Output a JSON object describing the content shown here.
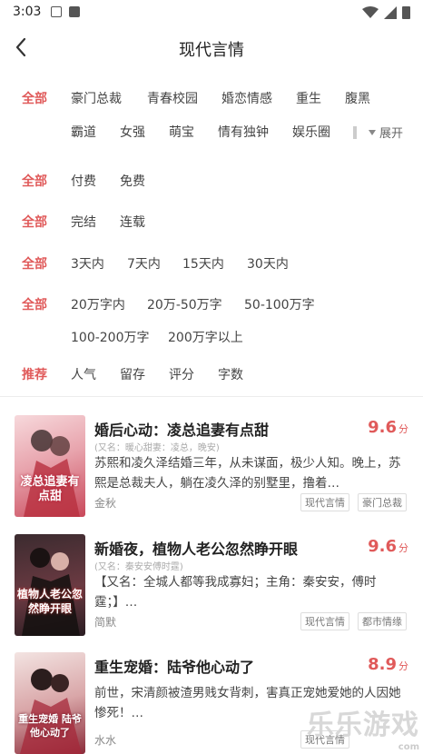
{
  "status": {
    "time": "3:03"
  },
  "header": {
    "title": "现代言情"
  },
  "filters": {
    "row1": [
      "全部",
      "豪门总裁",
      "青春校园",
      "婚恋情感",
      "重生",
      "腹黑"
    ],
    "row2": [
      "霸道",
      "女强",
      "萌宝",
      "情有独钟",
      "娱乐圈"
    ],
    "expand_label": "展开",
    "pay": [
      "全部",
      "付费",
      "免费"
    ],
    "progress": [
      "全部",
      "完结",
      "连载"
    ],
    "time": [
      "全部",
      "3天内",
      "7天内",
      "15天内",
      "30天内"
    ],
    "words_a": [
      "全部",
      "20万字内",
      "20万-50万字",
      "50-100万字"
    ],
    "words_b": [
      "100-200万字",
      "200万字以上"
    ],
    "sort": [
      "推荐",
      "人气",
      "留存",
      "评分",
      "字数"
    ]
  },
  "books": [
    {
      "title": "婚后心动：凌总追妻有点甜",
      "alias": "(又名：暖心甜妻：凌总，晚安)",
      "desc": "苏熙和凌久泽结婚三年，从未谋面，极少人知。晚上，苏熙是总裁夫人，躺在凌久泽的别墅里，撸着…",
      "author": "金秋",
      "tags": [
        "现代言情",
        "豪门总裁"
      ],
      "score": "9.6",
      "unit": "分",
      "cover_text": "凌总追妻有点甜"
    },
    {
      "title": "新婚夜，植物人老公忽然睁开眼",
      "alias": "(又名：秦安安傅时霆)",
      "desc": "【又名：全城人都等我成寡妇；主角：秦安安，傅时霆；】…",
      "author": "简默",
      "tags": [
        "现代言情",
        "都市情缘"
      ],
      "score": "9.6",
      "unit": "分",
      "cover_text": "植物人老公忽然睁开眼"
    },
    {
      "title": "重生宠婚：陆爷他心动了",
      "alias": "",
      "desc": "前世，宋清颜被渣男贱女背刺，害真正宠她爱她的人因她惨死！…",
      "author": "水水",
      "tags": [
        "现代言情"
      ],
      "score": "8.9",
      "unit": "分",
      "cover_text": "重生宠婚 陆爷他心动了"
    }
  ],
  "watermark": {
    "text": "乐乐游戏",
    "sub": "com"
  }
}
